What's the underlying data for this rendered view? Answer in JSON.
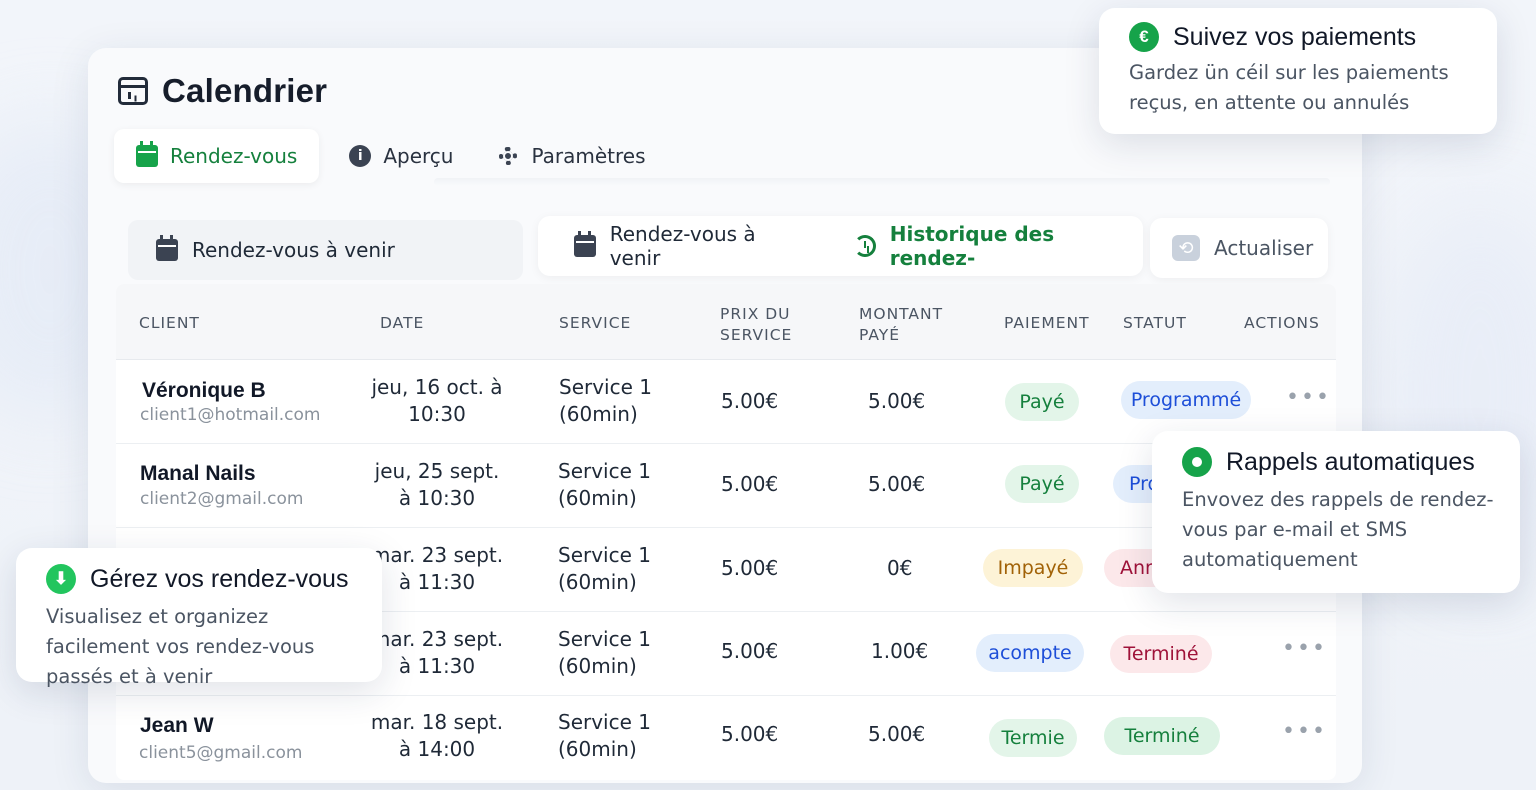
{
  "page": {
    "title": "Calendrier"
  },
  "tabs": [
    {
      "label": "Rendez-vous",
      "icon": "calendar-icon",
      "active": true
    },
    {
      "label": "Aperçu",
      "icon": "info-icon",
      "active": false
    },
    {
      "label": "Paramètres",
      "icon": "gear-icon",
      "active": false
    }
  ],
  "filters": {
    "upcoming_left": "Rendez-vous à venir",
    "upcoming_right": "Rendez-vous à venir",
    "history": "Historique des rendez-",
    "refresh": "Actualiser"
  },
  "table": {
    "headers": {
      "client": "CLIENT",
      "date": "DATE",
      "service": "SERVICE",
      "price_line1": "PRIX DU",
      "price_line2": "SERVICE",
      "paid_line1": "MONTANT",
      "paid_line2": "PAYÉ",
      "payment": "PAIEMENT",
      "status": "STATUT",
      "actions": "ACTIONS"
    },
    "rows": [
      {
        "name": "Véronique B",
        "email": "client1@hotmail.com",
        "date_l1": "jeu, 16 oct. à",
        "date_l2": "10:30",
        "service_l1": "Service 1",
        "service_l2": "(60min)",
        "price": "5.00€",
        "paid": "5.00€",
        "payment": "Payé",
        "status": "Programmé",
        "actions": "•••"
      },
      {
        "name": "Manal Nails",
        "email": "client2@gmail.com",
        "date_l1": "jeu, 25 sept.",
        "date_l2": "à 10:30",
        "service_l1": "Service 1",
        "service_l2": "(60min)",
        "price": "5.00€",
        "paid": "5.00€",
        "payment": "Payé",
        "status": "Pro",
        "actions": ""
      },
      {
        "name": "",
        "email": "",
        "date_l1": "mar. 23 sept.",
        "date_l2": "à 11:30",
        "service_l1": "Service 1",
        "service_l2": "(60min)",
        "price": "5.00€",
        "paid": "0€",
        "payment": "Impayé",
        "status": "Ann",
        "actions": ""
      },
      {
        "name": "",
        "email": "",
        "date_l1": "mar. 23 sept.",
        "date_l2": "à 11:30",
        "service_l1": "Service 1",
        "service_l2": "(60min)",
        "price": "5.00€",
        "paid": "1.00€",
        "payment": "acompte",
        "status": "Terminé",
        "actions": "•••"
      },
      {
        "name": "Jean W",
        "email": "client5@gmail.com",
        "date_l1": "mar. 18 sept.",
        "date_l2": "à 14:00",
        "service_l1": "Service 1",
        "service_l2": "(60min)",
        "price": "5.00€",
        "paid": "5.00€",
        "payment": "Termie",
        "status": "Terminé",
        "actions": "•••"
      }
    ]
  },
  "tooltips": {
    "payments": {
      "title": "Suivez vos paiements",
      "body": "Gardez ün céil sur les paiements reçus, en attente ou annulés",
      "icon": "euro-icon"
    },
    "reminders": {
      "title": "Rappels automatiques",
      "body": "Envovez des rappels de rendez-vous par e-mail et SMS automatiquement",
      "icon": "record-icon"
    },
    "manage": {
      "title": "Gérez vos rendez-vous",
      "body": "Visualisez et organizez facilement vos rendez-vous passés et à venir",
      "icon": "download-icon"
    }
  },
  "colors": {
    "brand_green": "#15803d",
    "paid_bg": "#e3f5e9",
    "scheduled_bg": "#e3eefc",
    "unpaid_bg": "#fdf3d7",
    "cancelled_bg": "#fce8ea",
    "done_bg": "#dcf3e4"
  }
}
